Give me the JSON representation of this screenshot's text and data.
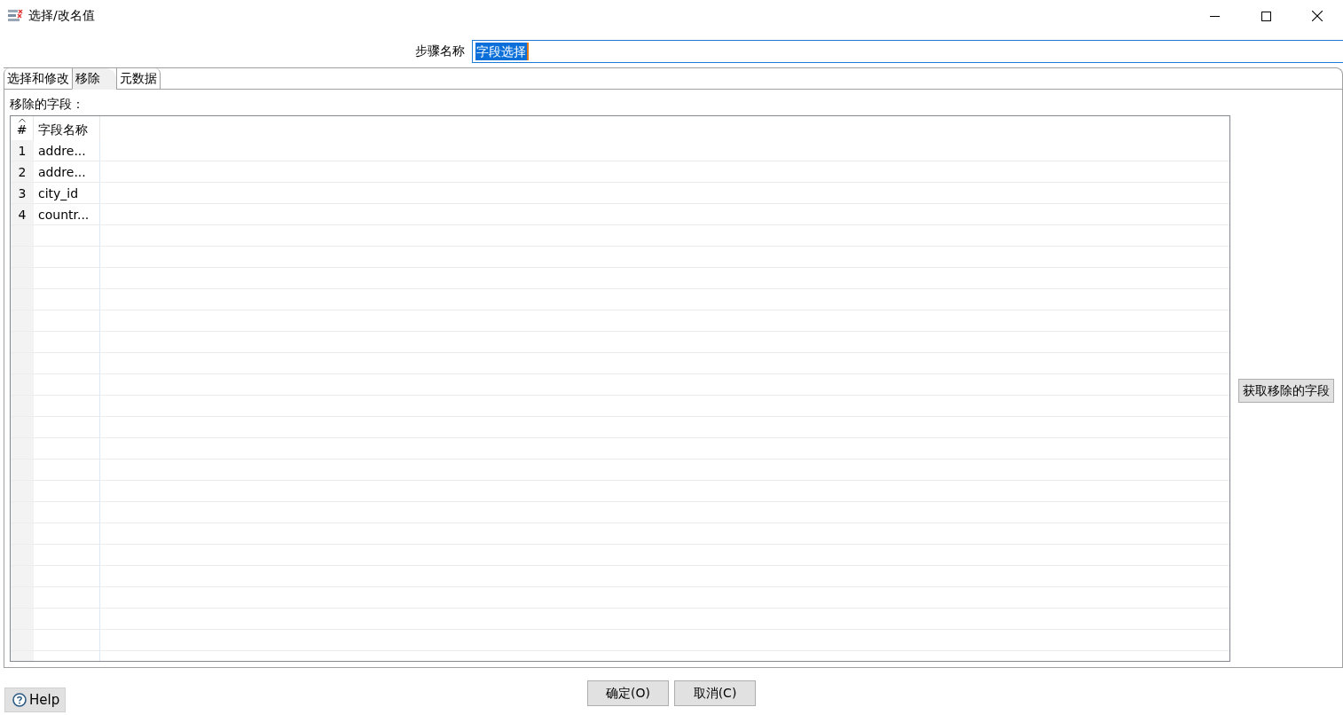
{
  "window": {
    "title": "选择/改名值"
  },
  "step_name": {
    "label": "步骤名称",
    "value": "字段选择",
    "value_selected": true
  },
  "tabs": [
    {
      "label": "选择和修改",
      "selected": false
    },
    {
      "label": "移除",
      "selected": true
    },
    {
      "label": "元数据",
      "selected": false
    }
  ],
  "remove_panel": {
    "label": "移除的字段：",
    "table": {
      "columns": [
        "#",
        "字段名称"
      ],
      "rows": [
        {
          "number": "1",
          "field_name": "addre..."
        },
        {
          "number": "2",
          "field_name": "addre..."
        },
        {
          "number": "3",
          "field_name": "city_id"
        },
        {
          "number": "4",
          "field_name": "countr..."
        }
      ]
    },
    "get_fields_button": "获取移除的字段"
  },
  "buttons": [
    {
      "label": "确定(O)"
    },
    {
      "label": "取消(C)"
    }
  ],
  "help_button": {
    "label": "Help"
  }
}
